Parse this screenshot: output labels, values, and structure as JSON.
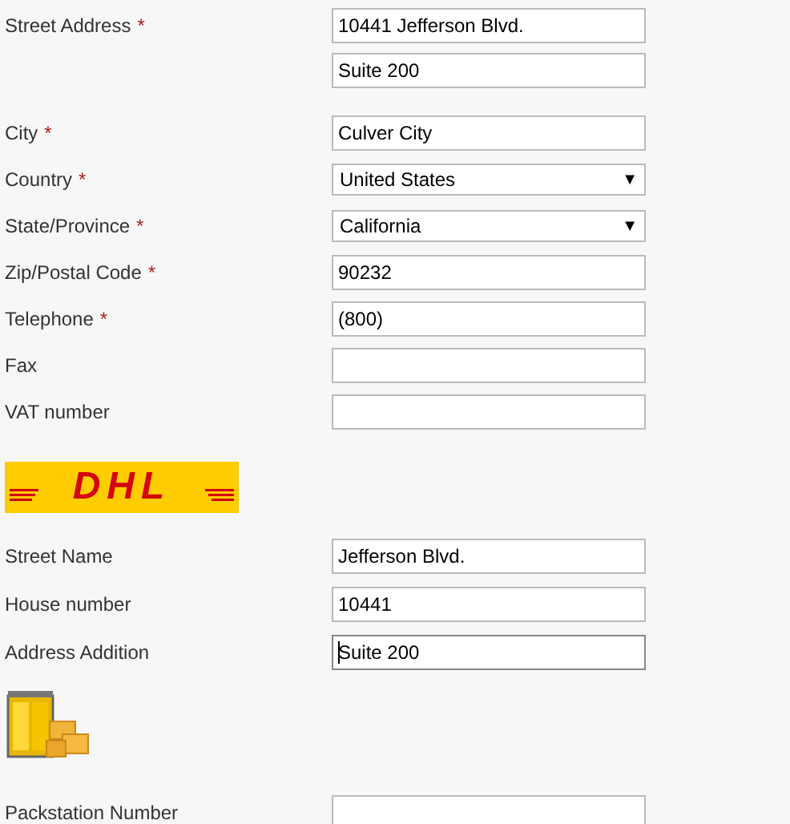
{
  "address_fields": [
    {
      "label": "Street Address",
      "required": true,
      "kind": "text",
      "value": "10441 Jefferson Blvd."
    },
    {
      "kind": "text",
      "value": "Suite 200"
    },
    {
      "label": "City",
      "required": true,
      "kind": "text",
      "value": "Culver City"
    },
    {
      "label": "Country",
      "required": true,
      "kind": "select",
      "value": "United States",
      "arrow": "▼"
    },
    {
      "label": "State/Province",
      "required": true,
      "kind": "select",
      "value": "California",
      "arrow": "▼"
    },
    {
      "label": "Zip/Postal Code",
      "required": true,
      "kind": "text",
      "value": "90232"
    },
    {
      "label": "Telephone",
      "required": true,
      "kind": "text",
      "value": "(800)"
    },
    {
      "label": "Fax",
      "required": false,
      "kind": "text"
    },
    {
      "label": "VAT number",
      "required": false,
      "kind": "text"
    }
  ],
  "required_mark": "*",
  "dhl_logo": {
    "text": "DHL"
  },
  "dhl_fields": [
    {
      "label": "Street Name",
      "value": "Jefferson Blvd.",
      "focused": false
    },
    {
      "label": "House number",
      "value": "10441",
      "focused": false
    },
    {
      "label": "Address Addition",
      "value": "Suite 200",
      "focused": true
    }
  ],
  "packstation_fields": [
    {
      "label": "Packstation Number"
    }
  ]
}
